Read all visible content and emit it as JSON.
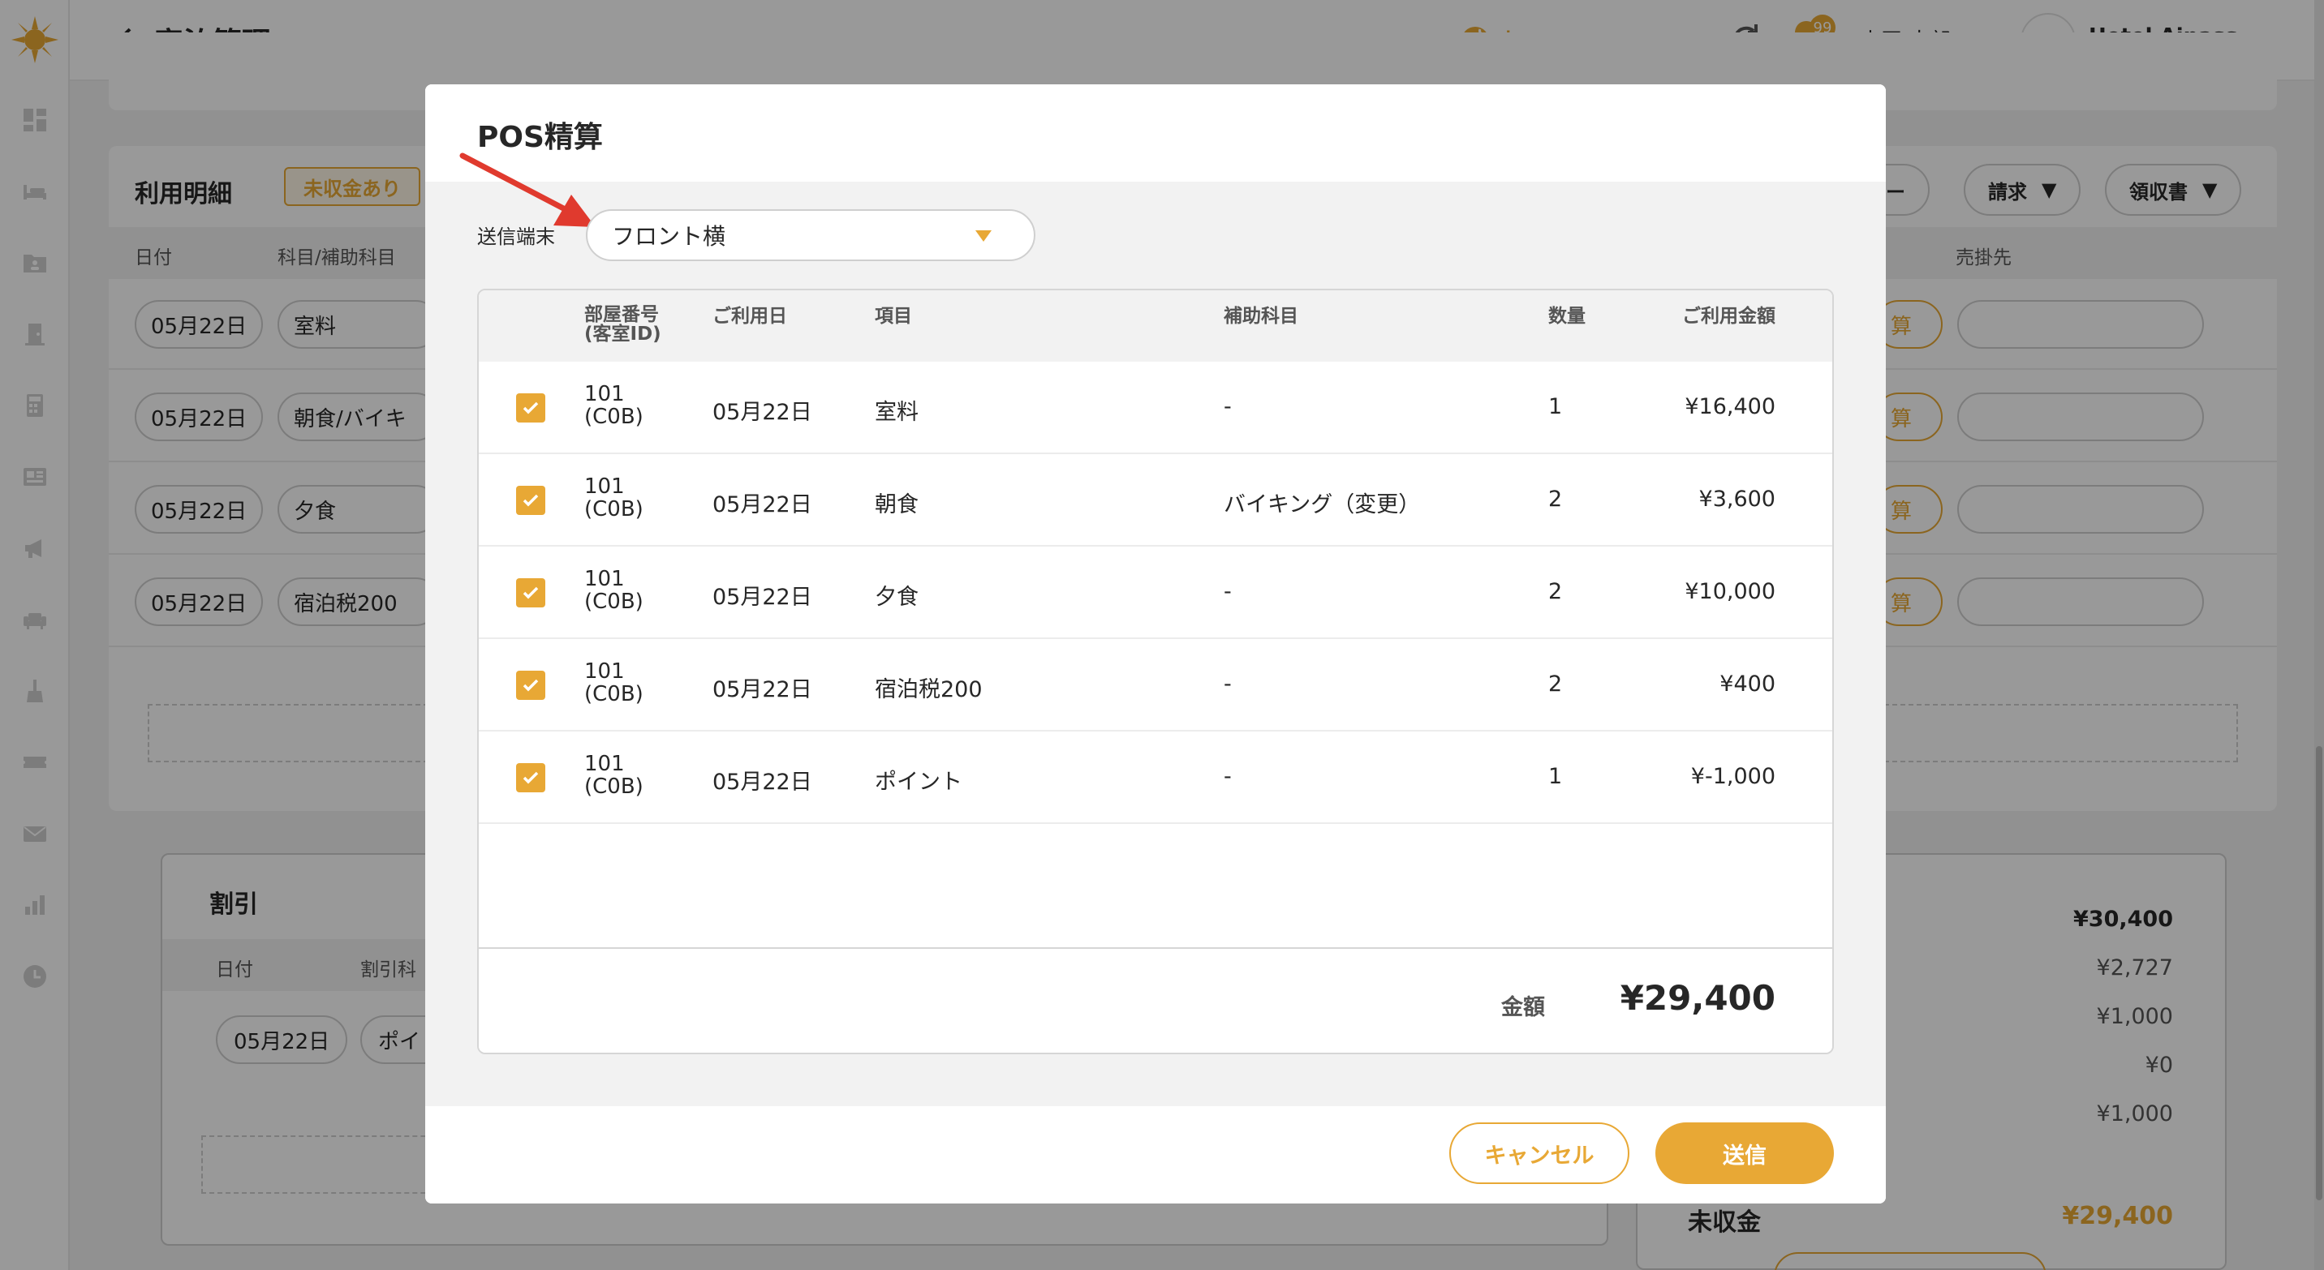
{
  "colors": {
    "accent": "#e8a835",
    "text": "#272727",
    "muted": "#555555",
    "overlay": "rgba(0,0,0,0.40)"
  },
  "header": {
    "title": "宿泊管理",
    "language_label": "Language",
    "notification_count": "99",
    "user_name": "山田 太郎",
    "hotel_logo_text": "ai",
    "hotel_name": "Hotel Aipass"
  },
  "sidebar": {
    "icons": [
      "dashboard-icon",
      "bed-icon",
      "guest-folder-icon",
      "door-icon",
      "calculator-icon",
      "news-icon",
      "megaphone-icon",
      "sofa-icon",
      "cleaning-icon",
      "ticket-icon",
      "mail-icon",
      "bar-chart-icon",
      "clock-icon"
    ]
  },
  "background": {
    "details_heading": "利用明細",
    "unpaid_badge": "未収金あり",
    "col_date": "日付",
    "col_subject": "科目/補助科目",
    "col_payee": "売掛先",
    "rows": [
      {
        "date": "05月22日",
        "subject": "室料"
      },
      {
        "date": "05月22日",
        "subject": "朝食/バイキ"
      },
      {
        "date": "05月22日",
        "subject": "夕食"
      },
      {
        "date": "05月22日",
        "subject": "宿泊税200"
      }
    ],
    "settle_fragment": "算",
    "btn_fragment": "ー",
    "btn_invoice": "請求",
    "btn_receipt": "領収書",
    "discount_heading": "割引",
    "discount_col_date": "日付",
    "discount_col_subject": "割引科",
    "discount_row_date": "05月22日",
    "discount_row_subject": "ポイ",
    "summary_values": [
      "¥30,400",
      "¥2,727",
      "¥1,000",
      "¥0",
      "¥1,000"
    ],
    "summary_unpaid_label": "未収金",
    "summary_unpaid_value": "¥29,400"
  },
  "modal": {
    "title": "POS精算",
    "terminal_label": "送信端末",
    "terminal_value": "フロント横",
    "columns": {
      "room": "部屋番号\n(客室ID)",
      "date": "ご利用日",
      "item": "項目",
      "sub_item": "補助科目",
      "qty": "数量",
      "amount": "ご利用金額"
    },
    "rows": [
      {
        "checked": true,
        "room": "101\n(C0B)",
        "date": "05月22日",
        "item": "室料",
        "sub_item": "-",
        "qty": "1",
        "amount": "¥16,400"
      },
      {
        "checked": true,
        "room": "101\n(C0B)",
        "date": "05月22日",
        "item": "朝食",
        "sub_item": "バイキング（変更）",
        "qty": "2",
        "amount": "¥3,600"
      },
      {
        "checked": true,
        "room": "101\n(C0B)",
        "date": "05月22日",
        "item": "夕食",
        "sub_item": "-",
        "qty": "2",
        "amount": "¥10,000"
      },
      {
        "checked": true,
        "room": "101\n(C0B)",
        "date": "05月22日",
        "item": "宿泊税200",
        "sub_item": "-",
        "qty": "2",
        "amount": "¥400"
      },
      {
        "checked": true,
        "room": "101\n(C0B)",
        "date": "05月22日",
        "item": "ポイント",
        "sub_item": "-",
        "qty": "1",
        "amount": "¥-1,000"
      }
    ],
    "total_label": "金額",
    "total_value": "¥29,400",
    "cancel_label": "キャンセル",
    "send_label": "送信"
  }
}
